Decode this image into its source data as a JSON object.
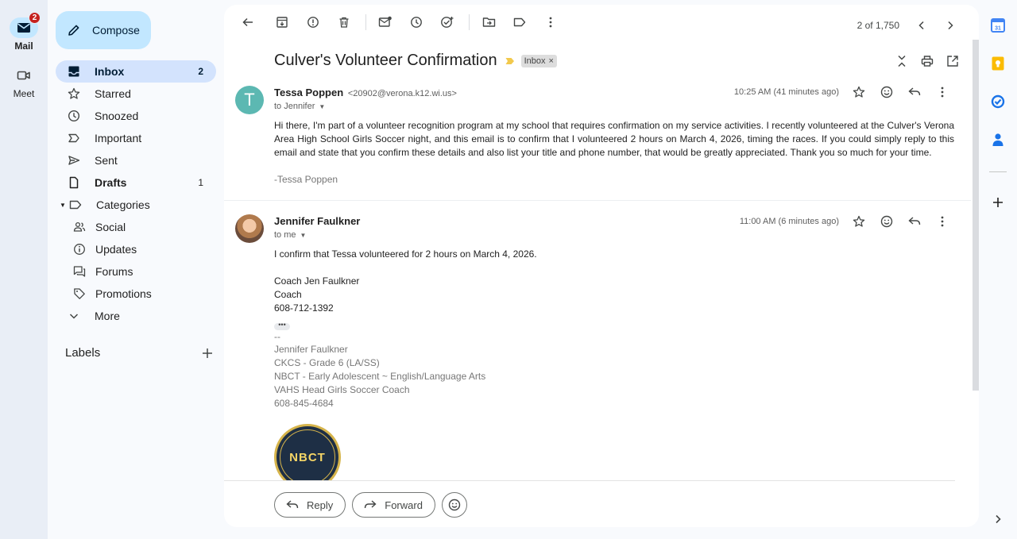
{
  "rail": {
    "mail": {
      "label": "Mail",
      "badge": "2"
    },
    "meet": {
      "label": "Meet"
    }
  },
  "compose": {
    "label": "Compose"
  },
  "nav": {
    "inbox": {
      "label": "Inbox",
      "count": "2"
    },
    "starred": {
      "label": "Starred"
    },
    "snoozed": {
      "label": "Snoozed"
    },
    "important": {
      "label": "Important"
    },
    "sent": {
      "label": "Sent"
    },
    "drafts": {
      "label": "Drafts",
      "count": "1"
    },
    "categories": {
      "label": "Categories"
    },
    "social": {
      "label": "Social"
    },
    "updates": {
      "label": "Updates"
    },
    "forums": {
      "label": "Forums"
    },
    "promotions": {
      "label": "Promotions"
    },
    "more": {
      "label": "More"
    }
  },
  "labels": {
    "title": "Labels"
  },
  "toolbar": {
    "pager_text": "2 of 1,750"
  },
  "thread": {
    "subject": "Culver's Volunteer Confirmation",
    "chip": "Inbox",
    "chip_close": "×"
  },
  "message1": {
    "avatar_letter": "T",
    "sender_name": "Tessa Poppen",
    "sender_email": "<20902@verona.k12.wi.us>",
    "to": "to Jennifer",
    "time": "10:25 AM (41 minutes ago)",
    "body": "Hi there, I'm part of a volunteer recognition program at my school that requires confirmation on my service activities. I recently volunteered at the Culver's Verona Area High School Girls Soccer night, and this email is to confirm that I volunteered 2 hours on March 4, 2026, timing the races. If you could simply reply to this email and state that you confirm these details and also list your title and phone number, that would be greatly appreciated. Thank you so much for your time.",
    "signoff": "-Tessa Poppen"
  },
  "message2": {
    "sender_name": "Jennifer Faulkner",
    "to": "to me",
    "time": "11:00 AM (6 minutes ago)",
    "line1": "I confirm that Tessa volunteered for 2 hours on March 4, 2026.",
    "sig_name": "Coach Jen Faulkner",
    "sig_title": "Coach",
    "sig_phone": "608-712-1392",
    "dots": "•••",
    "sig2_dash": "--",
    "sig2_name": "Jennifer Faulkner",
    "sig2_line1": "CKCS - Grade 6 (LA/SS)",
    "sig2_line2": "NBCT - Early Adolescent ~ English/Language Arts",
    "sig2_line3": "VAHS Head Girls Soccer Coach",
    "sig2_phone": "608-845-4684",
    "badge_text": "NBCT"
  },
  "reply_bar": {
    "reply": "Reply",
    "forward": "Forward"
  },
  "colors": {
    "accent": "#c2e7ff",
    "active_nav": "#d3e3fd",
    "important": "#f2c94c"
  }
}
